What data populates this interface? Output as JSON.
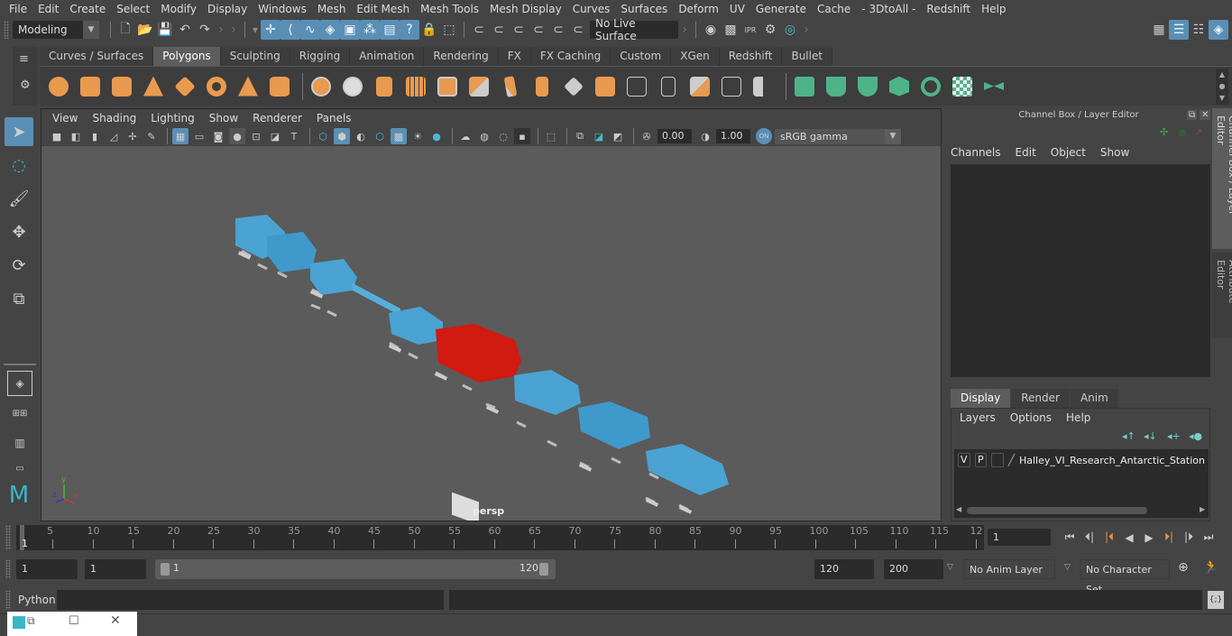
{
  "menubar": {
    "items": [
      "File",
      "Edit",
      "Create",
      "Select",
      "Modify",
      "Display",
      "Windows",
      "Mesh",
      "Edit Mesh",
      "Mesh Tools",
      "Mesh Display",
      "Curves",
      "Surfaces",
      "Deform",
      "UV",
      "Generate",
      "Cache",
      "- 3DtoAll -",
      "Redshift",
      "Help"
    ]
  },
  "statusline": {
    "mode": "Modeling",
    "live_surface": "No Live Surface"
  },
  "shelf": {
    "tabs": [
      "Curves / Surfaces",
      "Polygons",
      "Sculpting",
      "Rigging",
      "Animation",
      "Rendering",
      "FX",
      "FX Caching",
      "Custom",
      "XGen",
      "Redshift",
      "Bullet"
    ],
    "active_tab": "Polygons",
    "orange_icons": [
      "sphere-icon",
      "cube-icon",
      "cylinder-icon",
      "cone-icon",
      "plane-icon",
      "torus-icon",
      "pyramid-icon",
      "pipe-icon"
    ],
    "tool_icons": [
      "combine-icon",
      "separate-icon",
      "mirror-icon",
      "smooth-icon",
      "boolean-icon",
      "reduce-icon",
      "bevel-icon",
      "extrude-icon",
      "bridge-icon",
      "fill-hole-icon",
      "insert-edge-loop-icon",
      "multi-cut-icon",
      "target-weld-icon",
      "merge-icon",
      "quad-draw-icon"
    ],
    "green_icons": [
      "planar-uv-icon",
      "cylindrical-uv-icon",
      "spherical-uv-icon",
      "automatic-uv-icon",
      "unfold-uv-icon",
      "uv-editor-icon",
      "uv-layout-icon"
    ]
  },
  "viewport": {
    "menu": [
      "View",
      "Shading",
      "Lighting",
      "Show",
      "Renderer",
      "Panels"
    ],
    "exposure": "0.00",
    "gamma": "1.00",
    "color_space": "sRGB gamma",
    "color_mgmt": "ON",
    "camera_label": "persp",
    "axis": {
      "x": "x",
      "y": "y",
      "z": "z"
    }
  },
  "channel_box": {
    "title": "Channel Box / Layer Editor",
    "menu": [
      "Channels",
      "Edit",
      "Object",
      "Show"
    ],
    "layer_tabs": [
      "Display",
      "Render",
      "Anim"
    ],
    "active_layer_tab": "Display",
    "layer_menu": [
      "Layers",
      "Options",
      "Help"
    ],
    "layers": [
      {
        "v": "V",
        "p": "P",
        "name": "Halley_VI_Research_Antarctic_Station"
      }
    ]
  },
  "side_tabs": [
    "Channel Box / Layer Editor",
    "Attribute Editor"
  ],
  "timeline": {
    "ticks": [
      "5",
      "10",
      "15",
      "20",
      "25",
      "30",
      "35",
      "40",
      "45",
      "50",
      "55",
      "60",
      "65",
      "70",
      "75",
      "80",
      "85",
      "90",
      "95",
      "100",
      "105",
      "110",
      "115",
      "12"
    ],
    "current_frame_marker": "1",
    "current_frame": "1"
  },
  "range": {
    "start": "1",
    "playback_start": "1",
    "slider_start": "1",
    "slider_end": "120",
    "playback_end": "120",
    "end": "200",
    "anim_layer": "No Anim Layer",
    "character_set": "No Character Set"
  },
  "command": {
    "label": "Python"
  }
}
